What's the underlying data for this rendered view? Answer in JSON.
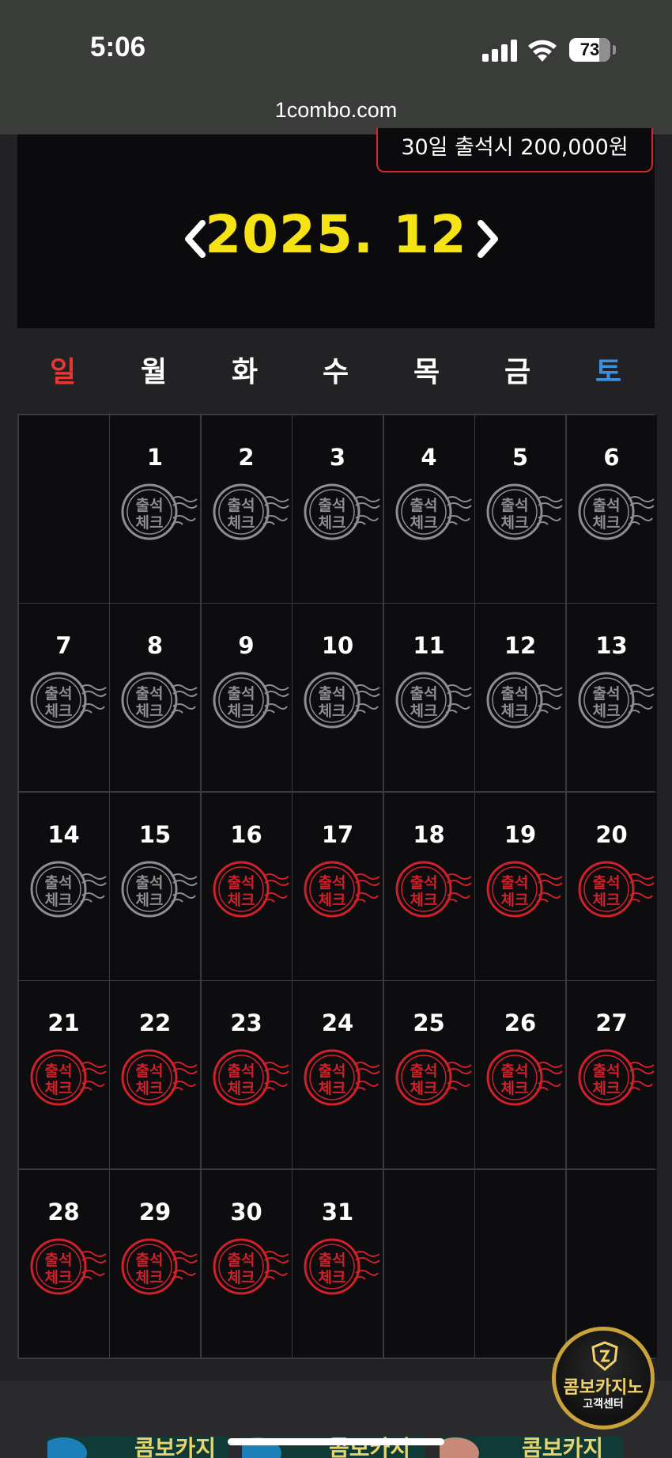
{
  "status_bar": {
    "time": "5:06",
    "battery": "73",
    "battery_level": 0.73
  },
  "browser": {
    "url": "1combo.com"
  },
  "header": {
    "bonus_text": "30일 출석시 200,000원",
    "month": "2025. 12"
  },
  "calendar": {
    "weekdays": [
      "일",
      "월",
      "화",
      "수",
      "목",
      "금",
      "토"
    ],
    "stamp_label": [
      "출석",
      "체크"
    ],
    "stamp_colors": {
      "inactive": "#8e8e90",
      "active": "#d0212a"
    },
    "days": [
      {
        "day": "1",
        "status": "inactive"
      },
      {
        "day": "2",
        "status": "inactive"
      },
      {
        "day": "3",
        "status": "inactive"
      },
      {
        "day": "4",
        "status": "inactive"
      },
      {
        "day": "5",
        "status": "inactive"
      },
      {
        "day": "6",
        "status": "inactive"
      },
      {
        "day": "7",
        "status": "inactive"
      },
      {
        "day": "8",
        "status": "inactive"
      },
      {
        "day": "9",
        "status": "inactive"
      },
      {
        "day": "10",
        "status": "inactive"
      },
      {
        "day": "11",
        "status": "inactive"
      },
      {
        "day": "12",
        "status": "inactive"
      },
      {
        "day": "13",
        "status": "inactive"
      },
      {
        "day": "14",
        "status": "inactive"
      },
      {
        "day": "15",
        "status": "inactive"
      },
      {
        "day": "16",
        "status": "active"
      },
      {
        "day": "17",
        "status": "active"
      },
      {
        "day": "18",
        "status": "active"
      },
      {
        "day": "19",
        "status": "active"
      },
      {
        "day": "20",
        "status": "active"
      },
      {
        "day": "21",
        "status": "active"
      },
      {
        "day": "22",
        "status": "active"
      },
      {
        "day": "23",
        "status": "active"
      },
      {
        "day": "24",
        "status": "active"
      },
      {
        "day": "25",
        "status": "active"
      },
      {
        "day": "26",
        "status": "active"
      },
      {
        "day": "27",
        "status": "active"
      },
      {
        "day": "28",
        "status": "active"
      },
      {
        "day": "29",
        "status": "active"
      },
      {
        "day": "30",
        "status": "active"
      },
      {
        "day": "31",
        "status": "active"
      }
    ]
  },
  "support_button": {
    "title": "콤보카지노",
    "subtitle": "고객센터"
  },
  "banners": [
    "콤보카지노",
    "콤보카지노",
    "콤보카지노"
  ],
  "colors": {
    "month": "#f5e316",
    "sunday": "#e23a33",
    "saturday": "#3d8fe0",
    "accent_border": "#d4282d"
  }
}
